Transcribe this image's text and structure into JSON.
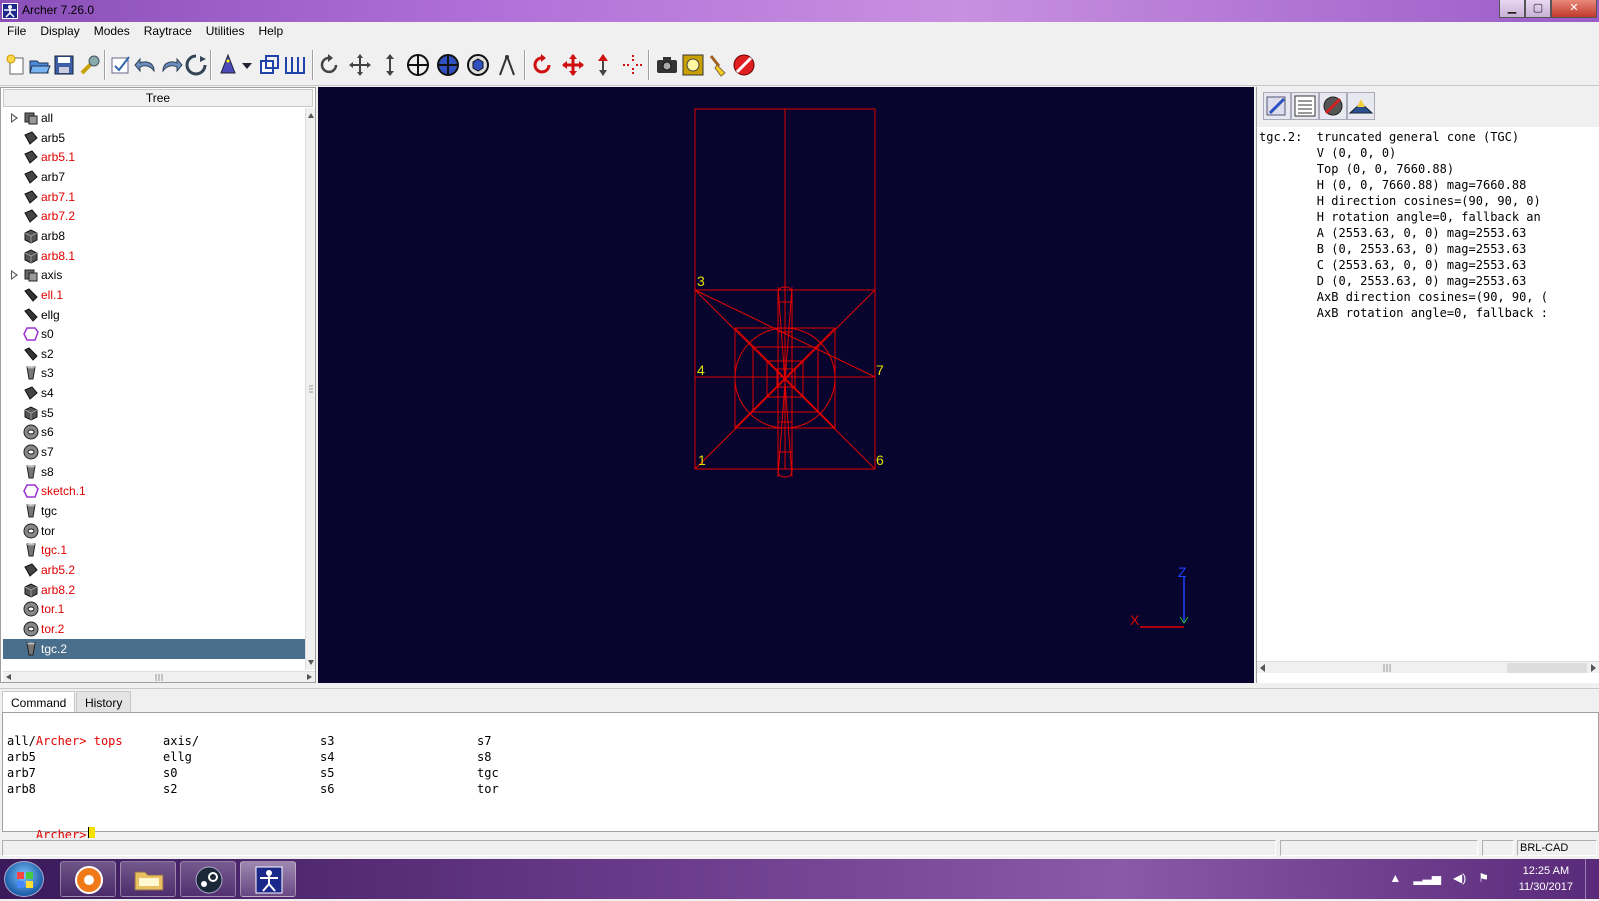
{
  "window": {
    "title": "Archer 7.26.0",
    "min_label": "▁",
    "max_label": "▢",
    "close_label": "✕"
  },
  "menu": [
    "File",
    "Display",
    "Modes",
    "Raytrace",
    "Utilities",
    "Help"
  ],
  "toolbar": {
    "icons": [
      "new-icon",
      "open-icon",
      "save-icon",
      "preferences-wrench-icon",
      "edit-check-icon",
      "undo-icon",
      "redo-icon",
      "revert-icon",
      "wizard-icon",
      "dropdown-icon",
      "layers-icon",
      "measure-icon",
      "rotate-icon",
      "move-icon",
      "scale-icon",
      "target-icon",
      "globe-icon",
      "cube-icon",
      "compass-icon",
      "rotate-red-icon",
      "translate-red-icon",
      "scale-red-icon",
      "center-icon",
      "camera-icon",
      "raytrace-icon",
      "clear-brush-icon",
      "no-entry-icon"
    ]
  },
  "tree": {
    "header": "Tree",
    "items": [
      {
        "label": "all",
        "type": "combination",
        "expandable": true,
        "red": false
      },
      {
        "label": "arb5",
        "type": "arb",
        "expandable": false,
        "red": false
      },
      {
        "label": "arb5.1",
        "type": "arb",
        "expandable": false,
        "red": true
      },
      {
        "label": "arb7",
        "type": "arb",
        "expandable": false,
        "red": false
      },
      {
        "label": "arb7.1",
        "type": "arb",
        "expandable": false,
        "red": true
      },
      {
        "label": "arb7.2",
        "type": "arb",
        "expandable": false,
        "red": true
      },
      {
        "label": "arb8",
        "type": "box",
        "expandable": false,
        "red": false
      },
      {
        "label": "arb8.1",
        "type": "box",
        "expandable": false,
        "red": true
      },
      {
        "label": "axis",
        "type": "combination",
        "expandable": true,
        "red": false
      },
      {
        "label": "ell.1",
        "type": "ell",
        "expandable": false,
        "red": true
      },
      {
        "label": "ellg",
        "type": "ell",
        "expandable": false,
        "red": false
      },
      {
        "label": "s0",
        "type": "sketch",
        "expandable": false,
        "red": false
      },
      {
        "label": "s2",
        "type": "ell",
        "expandable": false,
        "red": false
      },
      {
        "label": "s3",
        "type": "tgc",
        "expandable": false,
        "red": false
      },
      {
        "label": "s4",
        "type": "arb",
        "expandable": false,
        "red": false
      },
      {
        "label": "s5",
        "type": "box",
        "expandable": false,
        "red": false
      },
      {
        "label": "s6",
        "type": "torus",
        "expandable": false,
        "red": false
      },
      {
        "label": "s7",
        "type": "torus",
        "expandable": false,
        "red": false
      },
      {
        "label": "s8",
        "type": "tgc",
        "expandable": false,
        "red": false
      },
      {
        "label": "sketch.1",
        "type": "sketch",
        "expandable": false,
        "red": true
      },
      {
        "label": "tgc",
        "type": "tgc",
        "expandable": false,
        "red": false
      },
      {
        "label": "tor",
        "type": "torus",
        "expandable": false,
        "red": false
      },
      {
        "label": "tgc.1",
        "type": "tgc",
        "expandable": false,
        "red": true
      },
      {
        "label": "arb5.2",
        "type": "arb",
        "expandable": false,
        "red": true
      },
      {
        "label": "arb8.2",
        "type": "box",
        "expandable": false,
        "red": true
      },
      {
        "label": "tor.1",
        "type": "torus",
        "expandable": false,
        "red": true
      },
      {
        "label": "tor.2",
        "type": "torus",
        "expandable": false,
        "red": true
      },
      {
        "label": "tgc.2",
        "type": "tgc",
        "expandable": false,
        "red": true,
        "selected": true
      }
    ]
  },
  "viewport": {
    "vertex_labels": [
      "3",
      "4",
      "7",
      "1",
      "6"
    ],
    "axes": {
      "z": "Z",
      "x": "X"
    },
    "colors": {
      "background": "#07052e",
      "wireframe": "#e00000",
      "labels": "#e0e000",
      "axis_z": "#2040ff",
      "axis_x": "#e00000"
    }
  },
  "info_panel": {
    "buttons": [
      "edit-pencil-icon",
      "text-table-icon",
      "tools-icon",
      "view-terrain-icon"
    ],
    "lines": [
      "tgc.2:  truncated general cone (TGC)",
      "        V (0, 0, 0)",
      "        Top (0, 0, 7660.88)",
      "        H (0, 0, 7660.88) mag=7660.88",
      "        H direction cosines=(90, 90, 0)",
      "        H rotation angle=0, fallback an",
      "        A (2553.63, 0, 0) mag=2553.63",
      "        B (0, 2553.63, 0) mag=2553.63",
      "        C (2553.63, 0, 0) mag=2553.63",
      "        D (0, 2553.63, 0) mag=2553.63",
      "        AxB direction cosines=(90, 90, (",
      "        AxB rotation angle=0, fallback :"
    ]
  },
  "command": {
    "tabs": [
      "Command",
      "History"
    ],
    "prompt": "Archer>",
    "last_command": "tops",
    "output_rows": [
      [
        "all/",
        "axis/",
        "s3",
        "s7"
      ],
      [
        "arb5",
        "ellg",
        "s4",
        "s8"
      ],
      [
        "arb7",
        "s0",
        "s5",
        "tgc"
      ],
      [
        "arb8",
        "s2",
        "s6",
        "tor"
      ]
    ]
  },
  "status": {
    "right_label": "BRL-CAD"
  },
  "taskbar": {
    "apps": [
      "browser-icon",
      "file-explorer-icon",
      "steam-icon",
      "archer-icon"
    ],
    "time": "12:25 AM",
    "date": "11/30/2017"
  }
}
